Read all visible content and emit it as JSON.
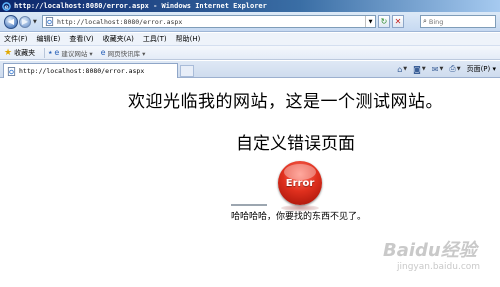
{
  "window": {
    "title": "http://localhost:8080/error.aspx - Windows Internet Explorer"
  },
  "address_bar": {
    "url": "http://localhost:8080/error.aspx"
  },
  "search": {
    "placeholder": "Bing"
  },
  "menu": {
    "items": [
      "文件(F)",
      "编辑(E)",
      "查看(V)",
      "收藏夹(A)",
      "工具(T)",
      "帮助(H)"
    ]
  },
  "favorites_bar": {
    "label": "收藏夹",
    "items": [
      "建议网站 ▾",
      "网页快讯库 ▾"
    ]
  },
  "tab": {
    "title": "http://localhost:8080/error.aspx"
  },
  "command_bar": {
    "page_label": "页面(P) ▾"
  },
  "page": {
    "welcome": "欢迎光临我的网站，这是一个测试网站。",
    "error_title": "自定义错误页面",
    "error_badge": "Error",
    "message": "哈哈哈哈，你要找的东西不见了。"
  },
  "watermark": {
    "text": "Baidu经验",
    "sub": "jingyan.baidu.com"
  },
  "colors": {
    "titlebar": "#0a246a",
    "error_red": "#e0301e"
  }
}
